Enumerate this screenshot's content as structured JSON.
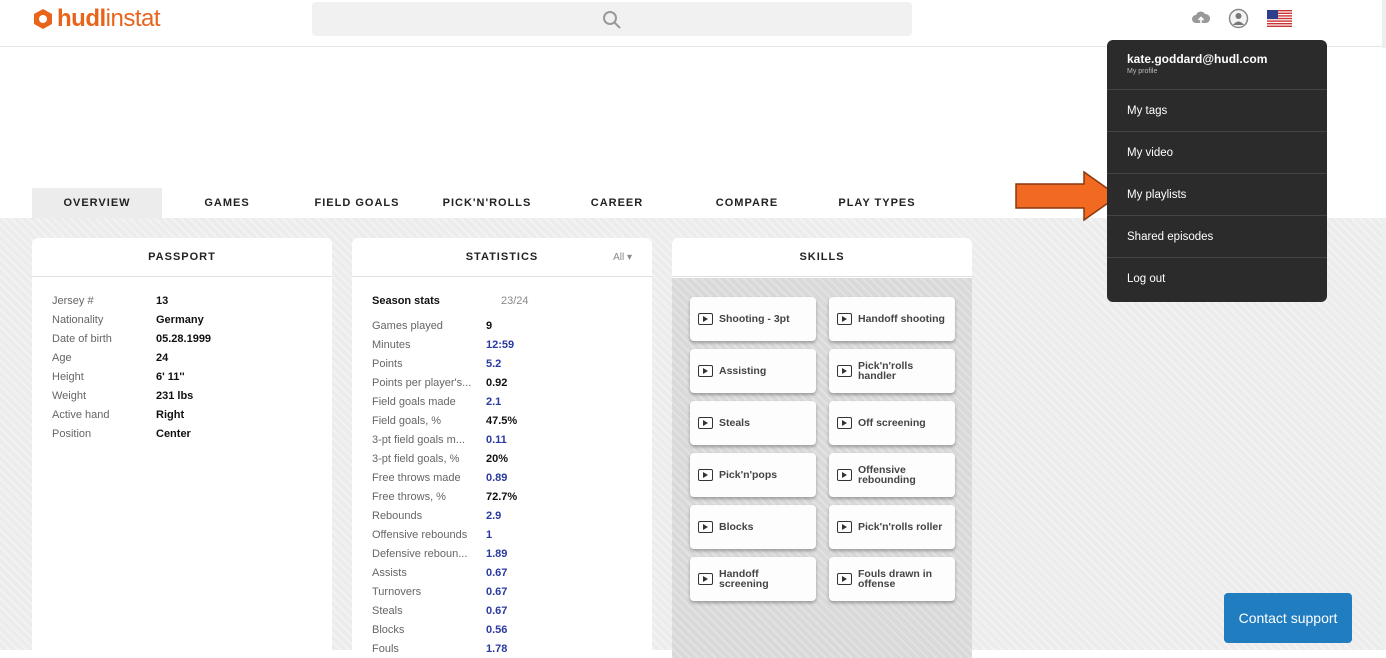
{
  "logo": {
    "hudl": "hudl",
    "instat": "instat"
  },
  "tabs": [
    "OVERVIEW",
    "GAMES",
    "FIELD GOALS",
    "PICK'N'ROLLS",
    "CAREER",
    "COMPARE",
    "PLAY TYPES"
  ],
  "passport": {
    "title": "PASSPORT",
    "rows": [
      {
        "label": "Jersey #",
        "value": "13"
      },
      {
        "label": "Nationality",
        "value": "Germany"
      },
      {
        "label": "Date of birth",
        "value": "05.28.1999"
      },
      {
        "label": "Age",
        "value": "24"
      },
      {
        "label": "Height",
        "value": "6' 11''"
      },
      {
        "label": "Weight",
        "value": "231 lbs"
      },
      {
        "label": "Active hand",
        "value": "Right"
      },
      {
        "label": "Position",
        "value": "Center"
      }
    ]
  },
  "statistics": {
    "title": "STATISTICS",
    "filter": "All",
    "season_label": "Season stats",
    "season": "23/24",
    "rows": [
      {
        "label": "Games played",
        "value": "9",
        "link": false
      },
      {
        "label": "Minutes",
        "value": "12:59",
        "link": true
      },
      {
        "label": "Points",
        "value": "5.2",
        "link": true
      },
      {
        "label": "Points per player's...",
        "value": "0.92",
        "link": false
      },
      {
        "label": "Field goals made",
        "value": "2.1",
        "link": true
      },
      {
        "label": "Field goals, %",
        "value": "47.5%",
        "link": false
      },
      {
        "label": "3-pt field goals m...",
        "value": "0.11",
        "link": true
      },
      {
        "label": "3-pt field goals, %",
        "value": "20%",
        "link": false
      },
      {
        "label": "Free throws made",
        "value": "0.89",
        "link": true
      },
      {
        "label": "Free throws, %",
        "value": "72.7%",
        "link": false
      },
      {
        "label": "Rebounds",
        "value": "2.9",
        "link": true
      },
      {
        "label": "Offensive rebounds",
        "value": "1",
        "link": true
      },
      {
        "label": "Defensive reboun...",
        "value": "1.89",
        "link": true
      },
      {
        "label": "Assists",
        "value": "0.67",
        "link": true
      },
      {
        "label": "Turnovers",
        "value": "0.67",
        "link": true
      },
      {
        "label": "Steals",
        "value": "0.67",
        "link": true
      },
      {
        "label": "Blocks",
        "value": "0.56",
        "link": true
      },
      {
        "label": "Fouls",
        "value": "1.78",
        "link": true
      }
    ]
  },
  "skills": {
    "title": "SKILLS",
    "items": [
      "Shooting - 3pt",
      "Handoff shooting",
      "Assisting",
      "Pick'n'rolls handler",
      "Steals",
      "Off screening",
      "Pick'n'pops",
      "Offensive rebounding",
      "Blocks",
      "Pick'n'rolls roller",
      "Handoff screening",
      "Fouls drawn in offense"
    ]
  },
  "user_menu": {
    "email": "kate.goddard@hudl.com",
    "profile": "My profile",
    "items": [
      "My tags",
      "My video",
      "My playlists",
      "Shared episodes",
      "Log out"
    ]
  },
  "support": "Contact support",
  "colors": {
    "brand": "#e8641b",
    "link": "#2a3aa0",
    "menu_bg": "#2b2b2b",
    "support_bg": "#1f7dc0",
    "arrow": "#f26a21"
  }
}
